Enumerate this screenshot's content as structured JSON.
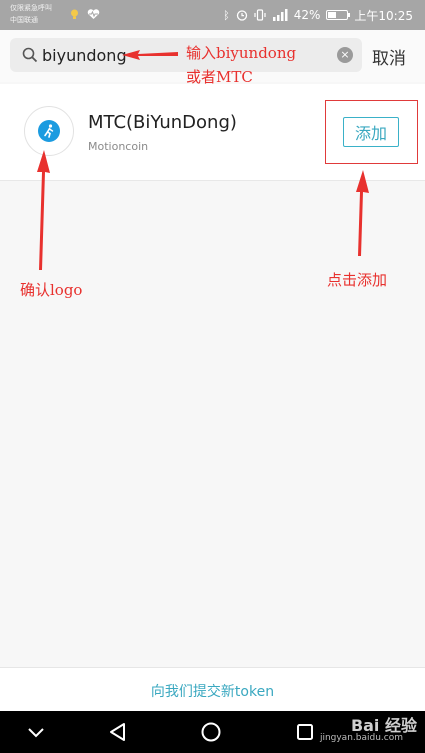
{
  "status_bar": {
    "carrier_line1": "仅限紧急呼叫",
    "carrier_line2": "中国联通",
    "battery_percent": 42,
    "battery_label": "42%",
    "time": "上午10:25"
  },
  "search": {
    "value": "biyundong",
    "cancel_label": "取消",
    "clear_glyph": "×"
  },
  "result": {
    "name": "MTC(BiYunDong)",
    "subtitle": "Motioncoin",
    "add_label": "添加"
  },
  "annotations": {
    "search_hint_line1": "输入biyundong",
    "search_hint_line2": "或者MTC",
    "logo_hint": "确认logo",
    "add_hint": "点击添加"
  },
  "footer": {
    "submit_link": "向我们提交新token"
  },
  "watermark": {
    "main": "Bai 经验",
    "sub": "jingyan.baidu.com"
  },
  "colors": {
    "accent": "#3aa8c0",
    "annotation_red": "#e8312e",
    "logo_blue": "#1b9be0"
  }
}
